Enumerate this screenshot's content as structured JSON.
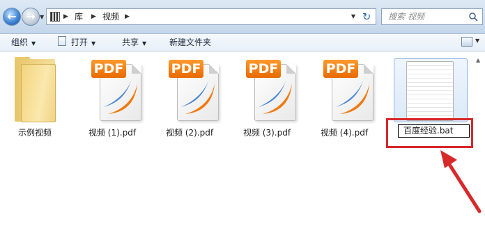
{
  "address_bar": {
    "breadcrumbs": [
      "库",
      "视频"
    ],
    "search_placeholder": "搜索 视频"
  },
  "toolbar": {
    "organize": "组织",
    "open": "打开",
    "share": "共享",
    "new_folder": "新建文件夹"
  },
  "files": [
    {
      "name": "示例视频",
      "type": "folder-icon"
    },
    {
      "name": "视频 (1).pdf",
      "type": "pdf-icon"
    },
    {
      "name": "视频 (2).pdf",
      "type": "pdf-icon"
    },
    {
      "name": "视频 (3).pdf",
      "type": "pdf-icon"
    },
    {
      "name": "视频 (4).pdf",
      "type": "pdf-icon"
    }
  ],
  "pdf_tag": "PDF",
  "rename": {
    "value": "百度经验.bat"
  },
  "colors": {
    "highlight": "#d8282a",
    "pdf_orange": "#f07a10",
    "pdf_blue": "#4a86d6"
  }
}
